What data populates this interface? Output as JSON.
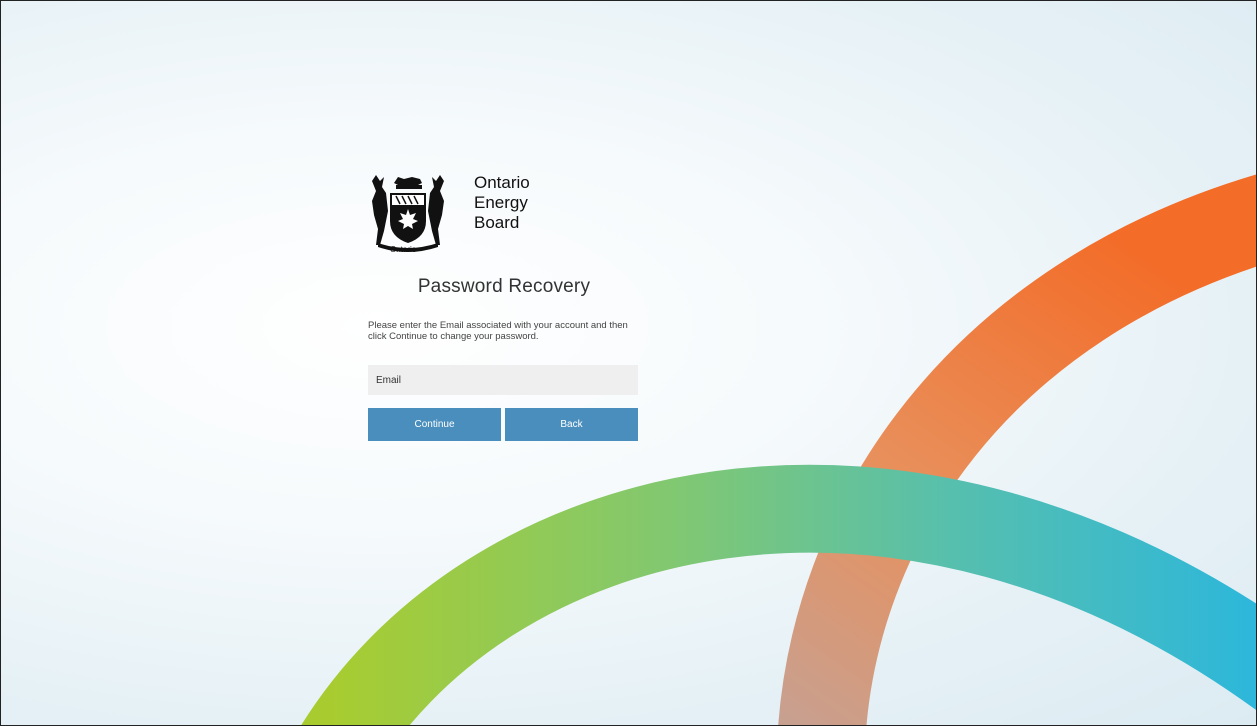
{
  "branding": {
    "crest_label": "Ontario",
    "org_name_lines": [
      "Ontario",
      "Energy",
      "Board"
    ]
  },
  "form": {
    "title": "Password Recovery",
    "instructions": "Please enter the Email associated with your account and then click Continue to change your password.",
    "email_placeholder": "Email",
    "email_value": "",
    "continue_label": "Continue",
    "back_label": "Back"
  },
  "colors": {
    "button": "#4a8ebd",
    "input_bg": "#efefef",
    "arc_orange": "#f07030",
    "arc_green": "#9ccc3c",
    "arc_teal": "#2fb8e0"
  },
  "icons": {
    "crest": "ontario-coat-of-arms"
  }
}
